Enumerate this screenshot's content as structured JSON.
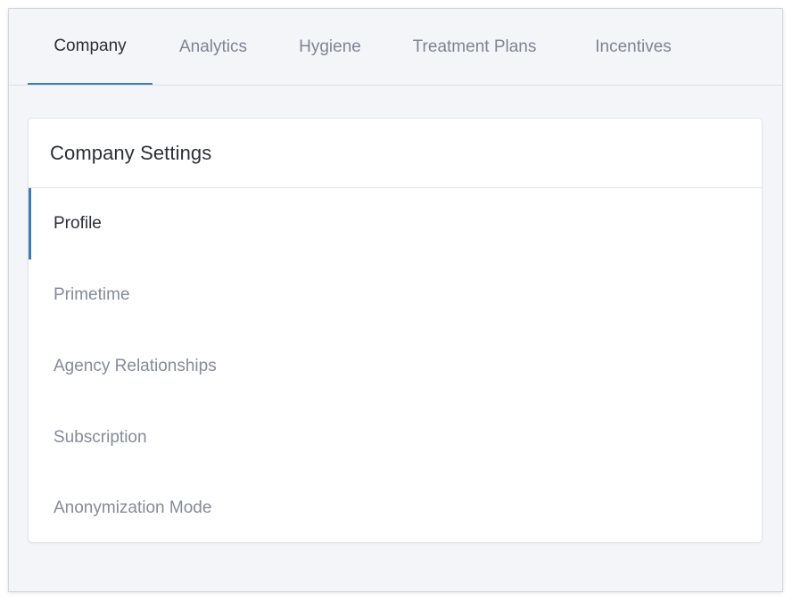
{
  "tabs": [
    {
      "label": "Company",
      "active": true
    },
    {
      "label": "Analytics",
      "active": false
    },
    {
      "label": "Hygiene",
      "active": false
    },
    {
      "label": "Treatment Plans",
      "active": false
    },
    {
      "label": "Incentives",
      "active": false
    }
  ],
  "settings": {
    "title": "Company Settings",
    "items": [
      {
        "label": "Profile",
        "active": true
      },
      {
        "label": "Primetime",
        "active": false
      },
      {
        "label": "Agency Relationships",
        "active": false
      },
      {
        "label": "Subscription",
        "active": false
      },
      {
        "label": "Anonymization Mode",
        "active": false
      }
    ]
  },
  "colors": {
    "accent": "#3a7db5",
    "background": "#f4f5f8",
    "active_text": "#2b2f36",
    "inactive_text": "#7d8593"
  }
}
